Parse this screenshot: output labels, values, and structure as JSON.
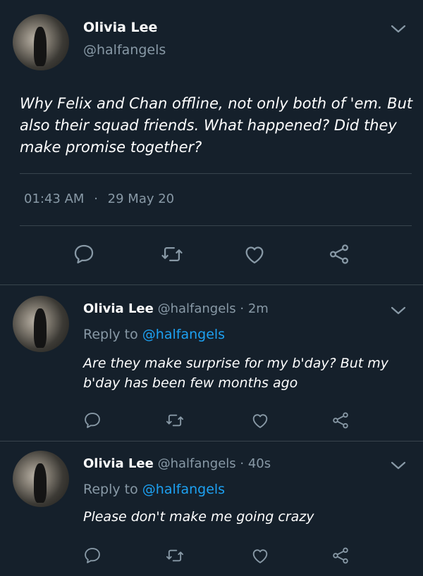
{
  "main_tweet": {
    "author_name": "Olivia Lee",
    "author_handle": "@halfangels",
    "text": "Why Felix and Chan offline, not only both of 'em. But also their squad friends. What happened? Did they make promise together?",
    "time": "01:43 AM",
    "separator": "·",
    "date": "29 May 20"
  },
  "replies": [
    {
      "author_name": "Olivia Lee",
      "author_handle": "@halfangels",
      "age": "· 2m",
      "reply_to_label": "Reply to",
      "reply_to_handle": "@halfangels",
      "text": "Are they make surprise for my b'day? But my b'day has been few months ago"
    },
    {
      "author_name": "Olivia Lee",
      "author_handle": "@halfangels",
      "age": "· 40s",
      "reply_to_label": "Reply to",
      "reply_to_handle": "@halfangels",
      "text": "Please don't make me going crazy"
    }
  ],
  "icons": [
    "comment-icon",
    "retweet-icon",
    "like-icon",
    "share-icon",
    "chevron-down-icon"
  ],
  "colors": {
    "background": "#15202b",
    "text": "#ffffff",
    "muted": "#8899a6",
    "accent": "#1da1f2",
    "divider": "#38444d"
  }
}
